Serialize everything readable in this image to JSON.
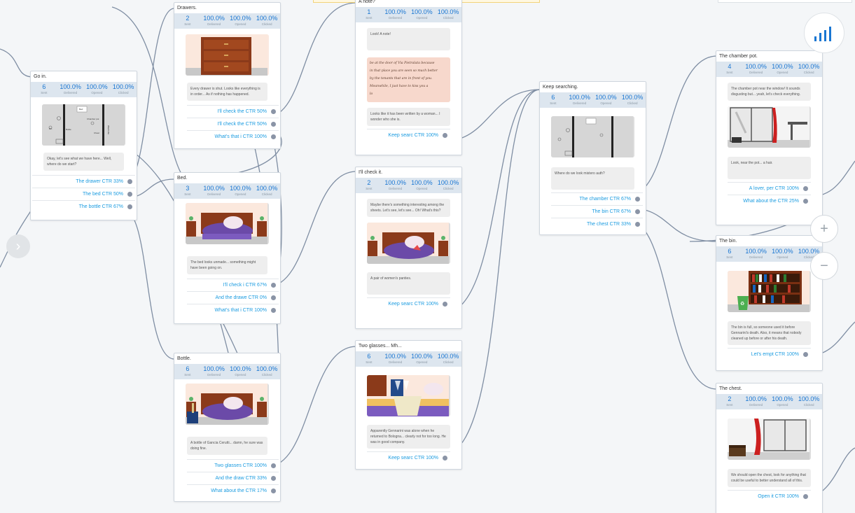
{
  "stat_labels": {
    "sent": "Sent",
    "delivered": "Delivered",
    "opened": "Opened",
    "clicked": "Clicked"
  },
  "nodes": {
    "goin": {
      "title": "Go in.",
      "sent": "6",
      "delivered": "100.0%",
      "opened": "100.0%",
      "clicked": "100.0%",
      "message": "Okay, let's see what we have here... Well, where do we start?",
      "buttons": [
        "The drawer CTR 33%",
        "The bed CTR 50%",
        "The bottle CTR 67%"
      ]
    },
    "drawers": {
      "title": "Drawers.",
      "sent": "2",
      "delivered": "100.0%",
      "opened": "100.0%",
      "clicked": "100.0%",
      "message": "Every drawer is shut. Looks like everything is in order... As if nothing has happened.",
      "buttons": [
        "I'll check the CTR 50%",
        "I'll check the CTR 50%",
        "What's that i CTR 100%"
      ]
    },
    "bed": {
      "title": "Bed.",
      "sent": "3",
      "delivered": "100.0%",
      "opened": "100.0%",
      "clicked": "100.0%",
      "message": "The bed looks unmade... something might have been going on.",
      "buttons": [
        "I'll check i CTR 67%",
        "And the drawe CTR 0%",
        "What's that i CTR 100%"
      ]
    },
    "bottle": {
      "title": "Bottle.",
      "sent": "6",
      "delivered": "100.0%",
      "opened": "100.0%",
      "clicked": "100.0%",
      "message": "A bottle of Gancia Cerutti... damn, he sure was doing fine.",
      "buttons": [
        "Two glasses CTR 100%",
        "And the draw CTR 33%",
        "What about the CTR 17%"
      ]
    },
    "note": {
      "title": "A note?",
      "sent": "1",
      "delivered": "100.0%",
      "opened": "100.0%",
      "clicked": "100.0%",
      "message1": "Look! A note!",
      "handwriting": [
        "be at the door of Via Pietralata because",
        "in that place you are seen so much better",
        "by the tenants that are in front of you.",
        "Meanwhile, I just have to kiss you a",
        "lo"
      ],
      "message2": "Looks like it has been written by a woman... I wonder who she is.",
      "buttons": [
        "Keep searc CTR 100%"
      ]
    },
    "checkit": {
      "title": "I'll check it.",
      "sent": "2",
      "delivered": "100.0%",
      "opened": "100.0%",
      "clicked": "100.0%",
      "message1": "Maybe there's something interesting among the sheets. Let's see, let's see... Oh! What's this?",
      "message2": "A pair of women's panties.",
      "buttons": [
        "Keep searc CTR 100%"
      ]
    },
    "glasses": {
      "title": "Two glasses... Mh...",
      "sent": "6",
      "delivered": "100.0%",
      "opened": "100.0%",
      "clicked": "100.0%",
      "message": "Apparently Gennarini was alone when he returned to Bologna... clearly not for too long. He was in good company.",
      "buttons": [
        "Keep searc CTR 100%"
      ]
    },
    "keep": {
      "title": "Keep searching.",
      "sent": "6",
      "delivered": "100.0%",
      "opened": "100.0%",
      "clicked": "100.0%",
      "message": "Where do we look mistero auth?",
      "buttons": [
        "The chamber CTR 67%",
        "The bin CTR 67%",
        "The chest CTR 33%"
      ]
    },
    "chamberpot": {
      "title": "The chamber pot.",
      "sent": "4",
      "delivered": "100.0%",
      "opened": "100.0%",
      "clicked": "100.0%",
      "message1": "The chamber pot near the window! It sounds disgusting but... yeah, let's check everything.",
      "message2": "Look, near the pot... a hair.",
      "buttons": [
        "A lover, per CTR 100%",
        "What about the CTR 25%"
      ]
    },
    "bin": {
      "title": "The bin.",
      "sent": "6",
      "delivered": "100.0%",
      "opened": "100.0%",
      "clicked": "100.0%",
      "message": "The bin is full, so someone used it before Gennarini's death. Also, it means that nobody cleaned up before or after his death.",
      "buttons": [
        "Let's empt CTR 100%"
      ]
    },
    "chest": {
      "title": "The chest.",
      "sent": "2",
      "delivered": "100.0%",
      "opened": "100.0%",
      "clicked": "100.0%",
      "message": "We should open the chest, look for anything that could be useful to better understand all of this.",
      "buttons": [
        "Open it CTR 100%"
      ]
    }
  },
  "floorplan_labels": {
    "bed": "Bed",
    "chamber": "Chamber pot",
    "chest": "Chest",
    "bottle": "Bottle",
    "wardrobe": "Wardrobe",
    "bin": "Bin"
  },
  "controls": {
    "zoom_in": "+",
    "zoom_out": "−",
    "expand": "›"
  },
  "icons": {
    "analytics": "bar-chart-icon",
    "expand": "chevron-right-icon"
  },
  "colors": {
    "accent": "#1976d2",
    "link": "#1a9be0",
    "wire": "#7f8ea3",
    "header": "#dde6ef"
  }
}
